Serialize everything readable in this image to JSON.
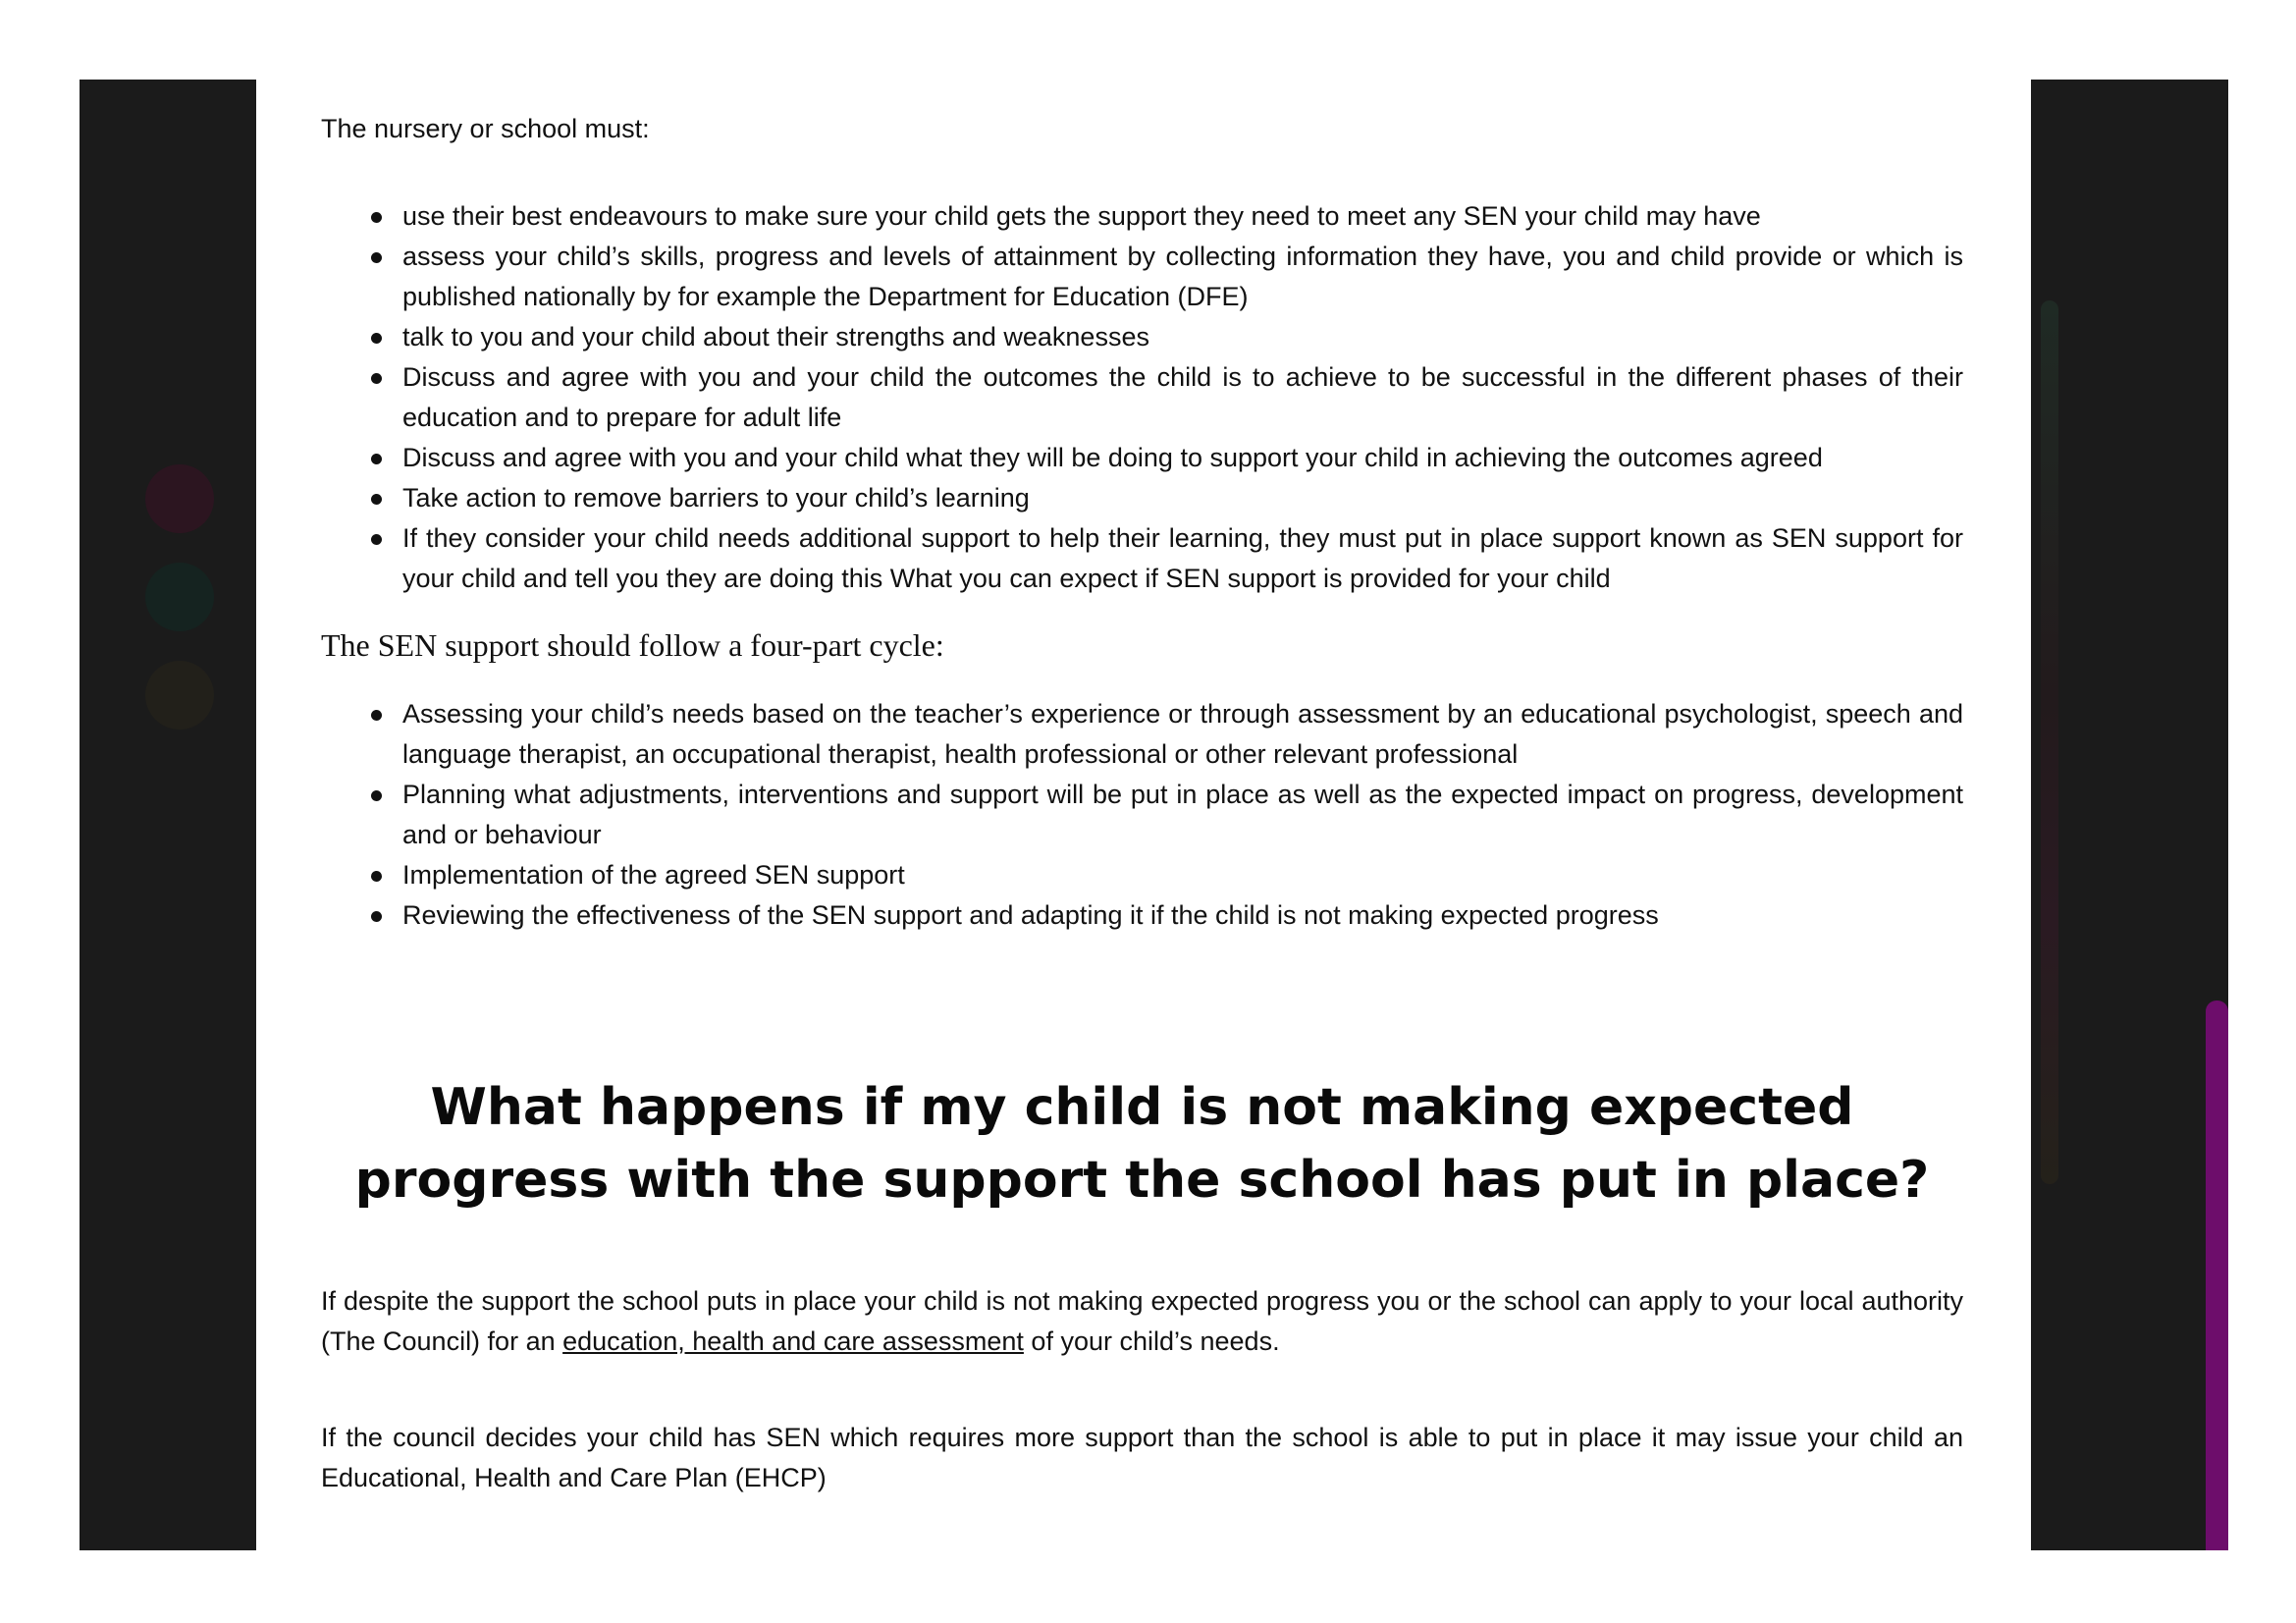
{
  "intro": "The nursery or school must:",
  "must_list": [
    "use their best endeavours to make sure your child gets the support they need to meet any SEN your child may have",
    "assess your child’s skills, progress and levels of attainment by collecting information they have, you and child provide or which is published nationally by for example the Department for Education (DFE)",
    "talk to you and your child about their strengths and weaknesses",
    "Discuss and agree with you and your child the outcomes the child is to achieve to be successful in the different phases of their education and to prepare for adult life",
    "Discuss and agree with you and your child what they will be doing to support your child in achieving the outcomes agreed",
    "Take action to remove barriers to your child’s learning",
    "If they consider your child needs additional support to help their learning, they must put in place support known as SEN support for your child and tell you they are doing this What you can expect if SEN support is provided for your child"
  ],
  "cycle_title": "The SEN support should follow a four-part cycle:",
  "cycle_list": [
    "Assessing your child’s needs based on the teacher’s experience or through assessment by an educational psychologist, speech and language therapist, an occupational therapist, health professional or other relevant professional",
    "Planning what adjustments, interventions and support will be put in place as well as the expected impact on progress, development and or behaviour",
    "Implementation of the agreed SEN support",
    "Reviewing the effectiveness of the SEN support and adapting it if the child is not making expected progress"
  ],
  "question_heading": "What happens if my child is not making expected progress with the support the school has put in place?",
  "paragraph1": {
    "before": "If despite the support the school puts in place your child is not making expected progress you or the school can apply to your local authority (The Council) for an ",
    "link": "education, health and care assessment",
    "after": " of your child’s needs."
  },
  "paragraph2": "If the council decides your child has SEN which requires more support than the school is able to put in place it may issue your child an Educational, Health and Care Plan (EHCP)",
  "colors": {
    "panel": "#1b1b1b",
    "scroll_accent": "#6d0d6b",
    "ghost_pink": "#4a1030",
    "ghost_teal": "#0f2a2a",
    "ghost_olive": "#2a2410"
  }
}
